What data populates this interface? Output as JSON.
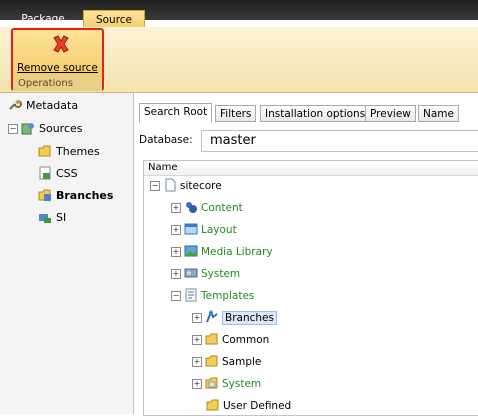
{
  "ribbon": {
    "tabs": [
      "Package",
      "Source"
    ],
    "active_tab": "Source",
    "remove_button_label": "Remove source",
    "group_label": "Operations"
  },
  "left_panel": {
    "items": [
      {
        "label": "Metadata",
        "icon": "wrench-icon",
        "expander": ""
      },
      {
        "label": "Sources",
        "icon": "sources-icon",
        "expander": "−"
      },
      {
        "label": "Themes",
        "icon": "folder-icon",
        "expander": ""
      },
      {
        "label": "CSS",
        "icon": "css-icon",
        "expander": ""
      },
      {
        "label": "Branches",
        "icon": "branches-icon",
        "expander": "",
        "bold": true
      },
      {
        "label": "SI",
        "icon": "si-icon",
        "expander": ""
      }
    ]
  },
  "source_tabs": [
    "Search Root",
    "Filters",
    "Installation options",
    "Preview",
    "Name"
  ],
  "database": {
    "label": "Database:",
    "value": "master"
  },
  "tree": {
    "column_header": "Name",
    "nodes": [
      {
        "label": "sitecore",
        "expander": "−",
        "icon": "page-icon",
        "color": "normal"
      },
      {
        "label": "Content",
        "expander": "+",
        "icon": "content-icon",
        "color": "green"
      },
      {
        "label": "Layout",
        "expander": "+",
        "icon": "layout-icon",
        "color": "green"
      },
      {
        "label": "Media Library",
        "expander": "+",
        "icon": "media-icon",
        "color": "green"
      },
      {
        "label": "System",
        "expander": "+",
        "icon": "system-icon",
        "color": "green"
      },
      {
        "label": "Templates",
        "expander": "−",
        "icon": "templates-icon",
        "color": "green"
      },
      {
        "label": "Branches",
        "expander": "+",
        "icon": "branches-icon",
        "color": "normal",
        "selected": true
      },
      {
        "label": "Common",
        "expander": "+",
        "icon": "folder-icon",
        "color": "normal"
      },
      {
        "label": "Sample",
        "expander": "+",
        "icon": "folder-icon",
        "color": "normal"
      },
      {
        "label": "System",
        "expander": "+",
        "icon": "folder-icon",
        "color": "green"
      },
      {
        "label": "User Defined",
        "expander": "",
        "icon": "folder-icon",
        "color": "normal"
      }
    ]
  },
  "colors": {
    "accent": "#f7cf6c",
    "highlight_border": "#e0231c",
    "green_text": "#1e8c1e"
  }
}
